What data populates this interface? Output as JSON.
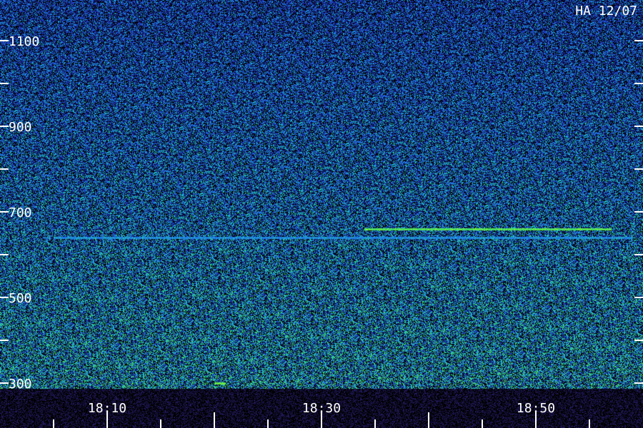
{
  "stamp": "HA 12/07",
  "chart_data": {
    "type": "heatmap",
    "title": "",
    "xlabel": "",
    "ylabel": "",
    "x_ticks": [
      {
        "time": "18:10",
        "label": "18:10"
      },
      {
        "time": "18:30",
        "label": "18:30"
      },
      {
        "time": "18:50",
        "label": "18:50"
      }
    ],
    "x_minor_tick_minutes": 5,
    "xlim": [
      "18:05",
      "18:59"
    ],
    "y_ticks": [
      {
        "value": 1100,
        "label": "1100"
      },
      {
        "value": 900,
        "label": "900"
      },
      {
        "value": 700,
        "label": "700"
      },
      {
        "value": 500,
        "label": "500"
      },
      {
        "value": 300,
        "label": "300"
      }
    ],
    "y_minor_ticks": [
      1000,
      800,
      600,
      400
    ],
    "ylim": [
      300,
      1100
    ],
    "colormap": [
      "#000000",
      "#1a1a80",
      "#1e3cc8",
      "#1e78e6",
      "#1eb4d2",
      "#28c89a",
      "#46e05a",
      "#8cf032",
      "#ffcc00"
    ],
    "features": [
      {
        "name": "",
        "start": "18:34",
        "end": "18:57",
        "value": 660,
        "intensity": 0.95
      },
      {
        "name": "",
        "start": "18:05",
        "end": "18:59",
        "value": 640,
        "intensity": 0.5
      },
      {
        "name": "",
        "start": "18:20",
        "end": "18:21",
        "value": 300,
        "intensity": 1.0
      }
    ]
  }
}
